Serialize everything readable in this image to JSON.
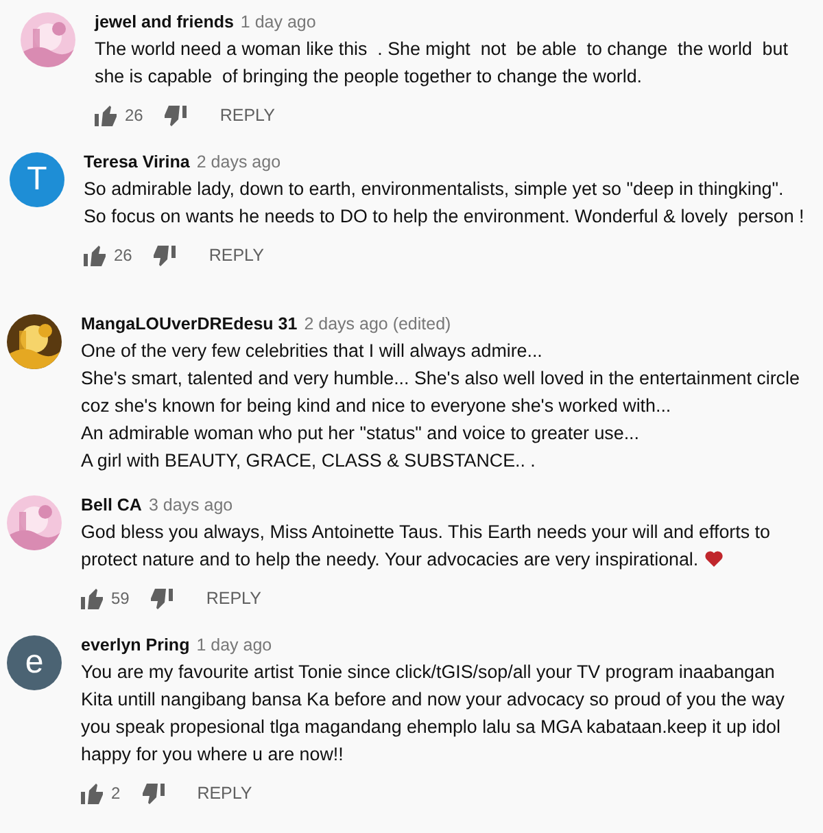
{
  "comments": [
    {
      "author": "jewel and friends",
      "time": "1 day ago",
      "lines": [
        "The world need a woman like this  . She might  not  be able  to change  the world  but",
        "she is capable  of bringing the people together to change the world."
      ],
      "heart": false,
      "likes": "26",
      "reply": "REPLY"
    },
    {
      "author": "Teresa Virina",
      "time": "2 days ago",
      "avatar": {
        "kind": "letter",
        "letter": "T",
        "color": "#1e8ed6"
      },
      "lines": [
        "So admirable lady, down to earth, environmentalists, simple yet so \"deep in thingking\".",
        "So focus on wants he needs to DO to help the environment. Wonderful & lovely  person !"
      ],
      "heart": false,
      "likes": "26",
      "reply": "REPLY"
    },
    {
      "author": "MangaLOUverDREdesu 31",
      "time": "2 days ago (edited)",
      "lines": [
        "One of the very few celebrities that I will always admire...",
        "She's smart, talented and very humble... She's also well loved in the entertainment circle",
        "coz she's known for being kind and nice to everyone she's worked with...",
        "An admirable woman who put her \"status\" and voice to greater use...",
        "A girl with BEAUTY, GRACE, CLASS & SUBSTANCE.. ."
      ],
      "heart": false
    },
    {
      "author": "Bell CA",
      "time": "3 days ago",
      "lines": [
        "God bless you always, Miss Antoinette Taus. This Earth needs your will and efforts to",
        "protect nature and to help the needy. Your advocacies are very inspirational."
      ],
      "heart": true,
      "likes": "59",
      "reply": "REPLY"
    },
    {
      "author": "everlyn Pring",
      "time": "1 day ago",
      "avatar": {
        "kind": "letter",
        "letter": "e",
        "color": "#4b6373"
      },
      "lines": [
        "You are my favourite artist Tonie since click/tGIS/sop/all your TV program inaabangan",
        "Kita untill nangibang bansa Ka before and now your advocacy so proud of you the way",
        "you speak propesional tlga magandang ehemplo lalu sa MGA kabataan.keep it up idol",
        "happy for you where u are now!!"
      ],
      "heart": false,
      "likes": "2",
      "reply": "REPLY"
    }
  ]
}
